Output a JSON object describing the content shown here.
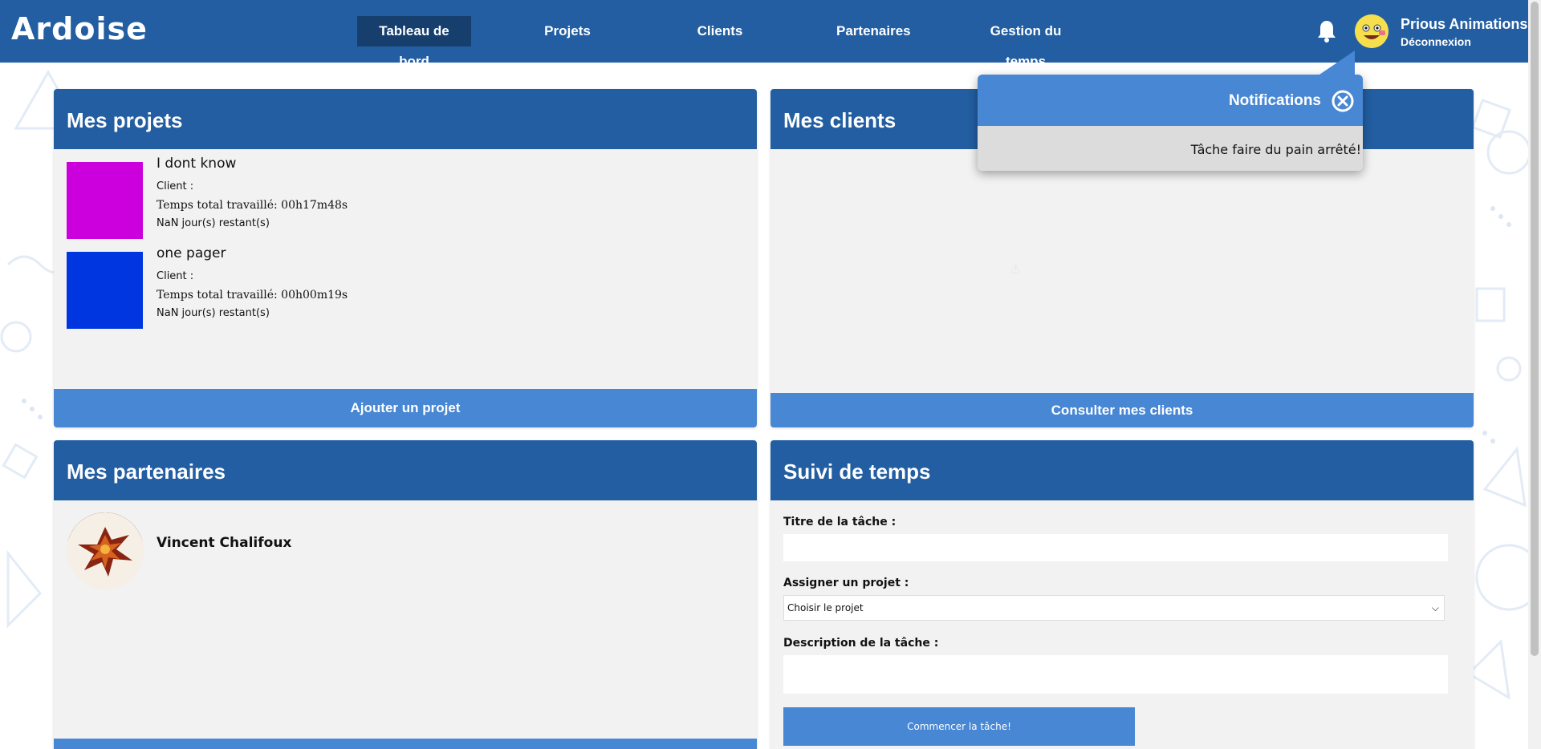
{
  "app": {
    "logo": "Ardoise"
  },
  "nav": {
    "items": [
      {
        "label": "Tableau de bord",
        "active": true
      },
      {
        "label": "Projets",
        "active": false
      },
      {
        "label": "Clients",
        "active": false
      },
      {
        "label": "Partenaires",
        "active": false
      },
      {
        "label": "Gestion du temps",
        "active": false
      }
    ]
  },
  "user": {
    "name": "Prious Animations",
    "logout": "Déconnexion",
    "icons": [
      "bell-icon",
      "avatar"
    ]
  },
  "projects_panel": {
    "title": "Mes projets",
    "items": [
      {
        "name": "I dont know",
        "client": "Client :",
        "time": "Temps total travaillé: 00h17m48s",
        "remaining": "NaN jour(s) restant(s)",
        "color": "#cc00dd"
      },
      {
        "name": "one pager",
        "client": "Client :",
        "time": "Temps total travaillé: 00h00m19s",
        "remaining": "NaN jour(s) restant(s)",
        "color": "#0036e0"
      }
    ],
    "button": "Ajouter un projet"
  },
  "clients_panel": {
    "title": "Mes clients",
    "button": "Consulter mes clients"
  },
  "partners_panel": {
    "title": "Mes partenaires",
    "items": [
      {
        "name": "Vincent Chalifoux"
      }
    ]
  },
  "time_panel": {
    "title": "Suivi de temps",
    "task_title_label": "Titre de la tâche :",
    "assign_label": "Assigner un projet :",
    "assign_value": "Choisir le projet",
    "description_label": "Description de la tâche :",
    "start_button": "Commencer la tâche!"
  },
  "notifications": {
    "title": "Notifications",
    "message": "Tâche faire du pain arrêté!"
  },
  "colors": {
    "header": "#225ea1",
    "accent": "#4787d3",
    "active_nav": "#163f6e",
    "panel_bg": "#f2f2f2"
  }
}
